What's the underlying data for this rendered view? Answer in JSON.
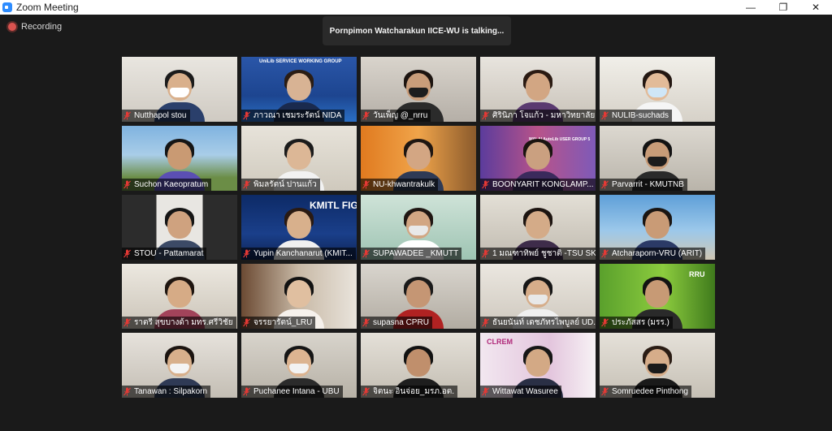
{
  "window": {
    "title": "Zoom Meeting",
    "minimize": "—",
    "maximize": "❐",
    "close": "✕"
  },
  "recording": {
    "label": "Recording"
  },
  "talking": {
    "text": "Pornpimon Watcharakun IICE-WU is talking..."
  },
  "tiles": [
    {
      "name": "Nutthapol stou"
    },
    {
      "name": "ภาวณา เชมระรัตน์ NIDA",
      "banner": "UniLib SERVICE WORKING GROUP"
    },
    {
      "name": "วันเพ็ญ @_nrru"
    },
    {
      "name": "ศิรินิภา โจแก้ว - มหาวิทยาลัย..."
    },
    {
      "name": "NULIB-suchads"
    },
    {
      "name": "Suchon Kaeopratum"
    },
    {
      "name": "พิมลรัตน์ ปานแก้ว"
    },
    {
      "name": "NU-khwantrakulk"
    },
    {
      "name": "BOONYARIT KONGLAMP...",
      "banner": "WALAI AutoLib USER GROUP 5"
    },
    {
      "name": "Parvarrit - KMUTNB"
    },
    {
      "name": "STOU - Pattamarat"
    },
    {
      "name": "Yupin Kanchanarut (KMIT...",
      "banner": "KMITL FIGHT"
    },
    {
      "name": "SUPAWADEE _KMUTT"
    },
    {
      "name": "1 มณฑาทิพย์ ชูชาติ -TSU SK"
    },
    {
      "name": "Atcharaporn-VRU (ARIT)"
    },
    {
      "name": "ราตรี สุขบางด้า มทร.ศรีวิชัย"
    },
    {
      "name": "จรรยารัตน์_LRU"
    },
    {
      "name": "supasna CPRU"
    },
    {
      "name": "ธันยนันท์ เดชภัทรไพบูลย์ UD..."
    },
    {
      "name": "ประภัสสร (มรร.)",
      "banner": "RRU"
    },
    {
      "name": "Tanawan : Silpakorn"
    },
    {
      "name": "Puchanee Intana - UBU"
    },
    {
      "name": "จิตนะ อินจ่อย_มรภ.อต."
    },
    {
      "name": "Wittawat Wasuree",
      "banner": "CLREM"
    },
    {
      "name": "Somruedee Pinthong"
    }
  ],
  "colors": {
    "muted": "#e53935",
    "background": "#1a1a1a",
    "accent": "#2d8cff"
  }
}
